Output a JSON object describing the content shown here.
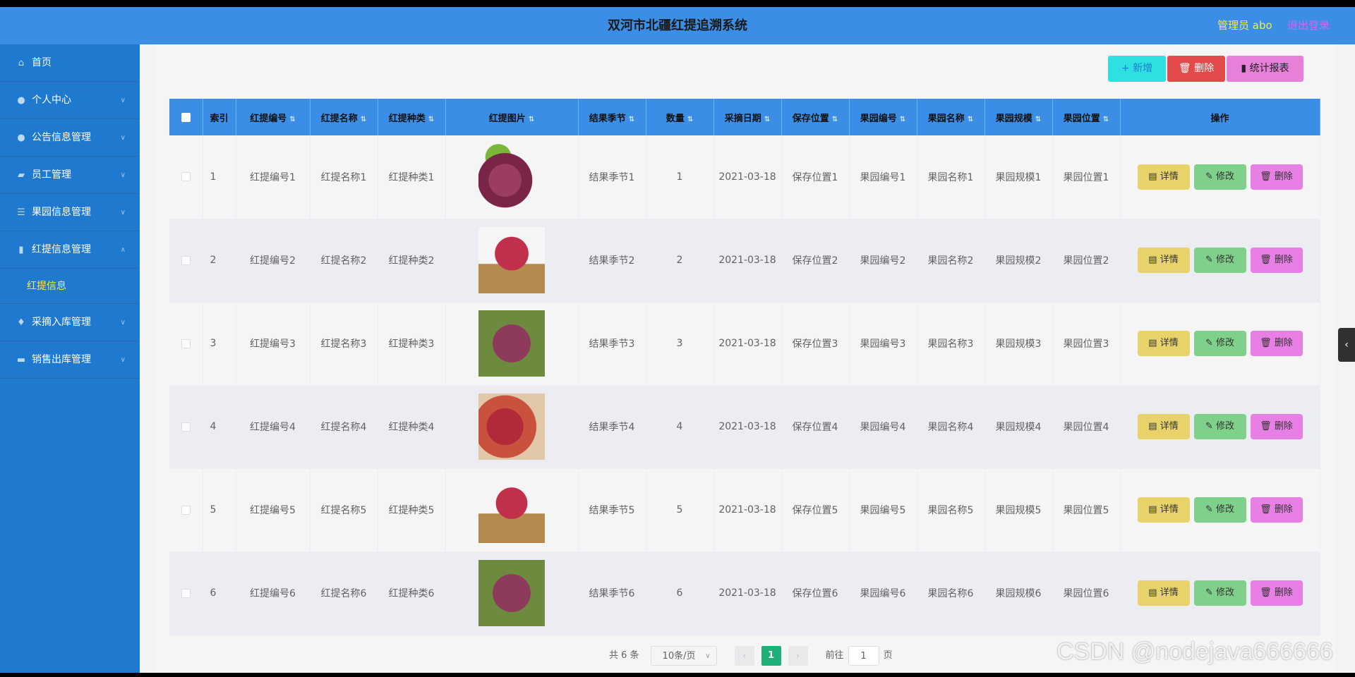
{
  "header": {
    "title": "双河市北疆红提追溯系统",
    "admin": "管理员 abo",
    "logout": "退出登录"
  },
  "sidebar": {
    "items": [
      {
        "label": "首页",
        "icon": "home-icon"
      },
      {
        "label": "个人中心",
        "icon": "user-icon"
      },
      {
        "label": "公告信息管理",
        "icon": "user-icon"
      },
      {
        "label": "员工管理",
        "icon": "briefcase-icon"
      },
      {
        "label": "果园信息管理",
        "icon": "sliders-icon"
      },
      {
        "label": "红提信息管理",
        "icon": "bar-chart-icon",
        "expanded": true
      },
      {
        "label": "采摘入库管理",
        "icon": "mic-icon"
      },
      {
        "label": "销售出库管理",
        "icon": "monitor-icon"
      }
    ],
    "submenu": {
      "label": "红提信息"
    }
  },
  "toolbar": {
    "add": "+ 新增",
    "delete": "删除",
    "stats": "统计报表"
  },
  "table": {
    "headers": [
      "索引",
      "红提编号",
      "红提名称",
      "红提种类",
      "红提图片",
      "结果季节",
      "数量",
      "采摘日期",
      "保存位置",
      "果园编号",
      "果园名称",
      "果园规模",
      "果园位置",
      "操作"
    ],
    "rows": [
      {
        "index": "1",
        "code": "红提编号1",
        "name": "红提名称1",
        "type": "红提种类1",
        "season": "结果季节1",
        "qty": "1",
        "date": "2021-03-18",
        "storage": "保存位置1",
        "orchard_code": "果园编号1",
        "orchard_name": "果园名称1",
        "orchard_scale": "果园规模1",
        "orchard_loc": "果园位置1"
      },
      {
        "index": "2",
        "code": "红提编号2",
        "name": "红提名称2",
        "type": "红提种类2",
        "season": "结果季节2",
        "qty": "2",
        "date": "2021-03-18",
        "storage": "保存位置2",
        "orchard_code": "果园编号2",
        "orchard_name": "果园名称2",
        "orchard_scale": "果园规模2",
        "orchard_loc": "果园位置2"
      },
      {
        "index": "3",
        "code": "红提编号3",
        "name": "红提名称3",
        "type": "红提种类3",
        "season": "结果季节3",
        "qty": "3",
        "date": "2021-03-18",
        "storage": "保存位置3",
        "orchard_code": "果园编号3",
        "orchard_name": "果园名称3",
        "orchard_scale": "果园规模3",
        "orchard_loc": "果园位置3"
      },
      {
        "index": "4",
        "code": "红提编号4",
        "name": "红提名称4",
        "type": "红提种类4",
        "season": "结果季节4",
        "qty": "4",
        "date": "2021-03-18",
        "storage": "保存位置4",
        "orchard_code": "果园编号4",
        "orchard_name": "果园名称4",
        "orchard_scale": "果园规模4",
        "orchard_loc": "果园位置4"
      },
      {
        "index": "5",
        "code": "红提编号5",
        "name": "红提名称5",
        "type": "红提种类5",
        "season": "结果季节5",
        "qty": "5",
        "date": "2021-03-18",
        "storage": "保存位置5",
        "orchard_code": "果园编号5",
        "orchard_name": "果园名称5",
        "orchard_scale": "果园规模5",
        "orchard_loc": "果园位置5"
      },
      {
        "index": "6",
        "code": "红提编号6",
        "name": "红提名称6",
        "type": "红提种类6",
        "season": "结果季节6",
        "qty": "6",
        "date": "2021-03-18",
        "storage": "保存位置6",
        "orchard_code": "果园编号6",
        "orchard_name": "果园名称6",
        "orchard_scale": "果园规模6",
        "orchard_loc": "果园位置6"
      }
    ],
    "actions": {
      "detail": "详情",
      "edit": "修改",
      "remove": "删除"
    }
  },
  "pager": {
    "total": "共 6 条",
    "size": "10条/页",
    "current": "1",
    "goto": "前往",
    "goto_value": "1",
    "page_unit": "页"
  },
  "watermark": "CSDN @nodejava666666",
  "colors": {
    "header": "#3a8ee6",
    "sidebar": "#1f7acf",
    "accent_yellow": "#f5e94d"
  }
}
